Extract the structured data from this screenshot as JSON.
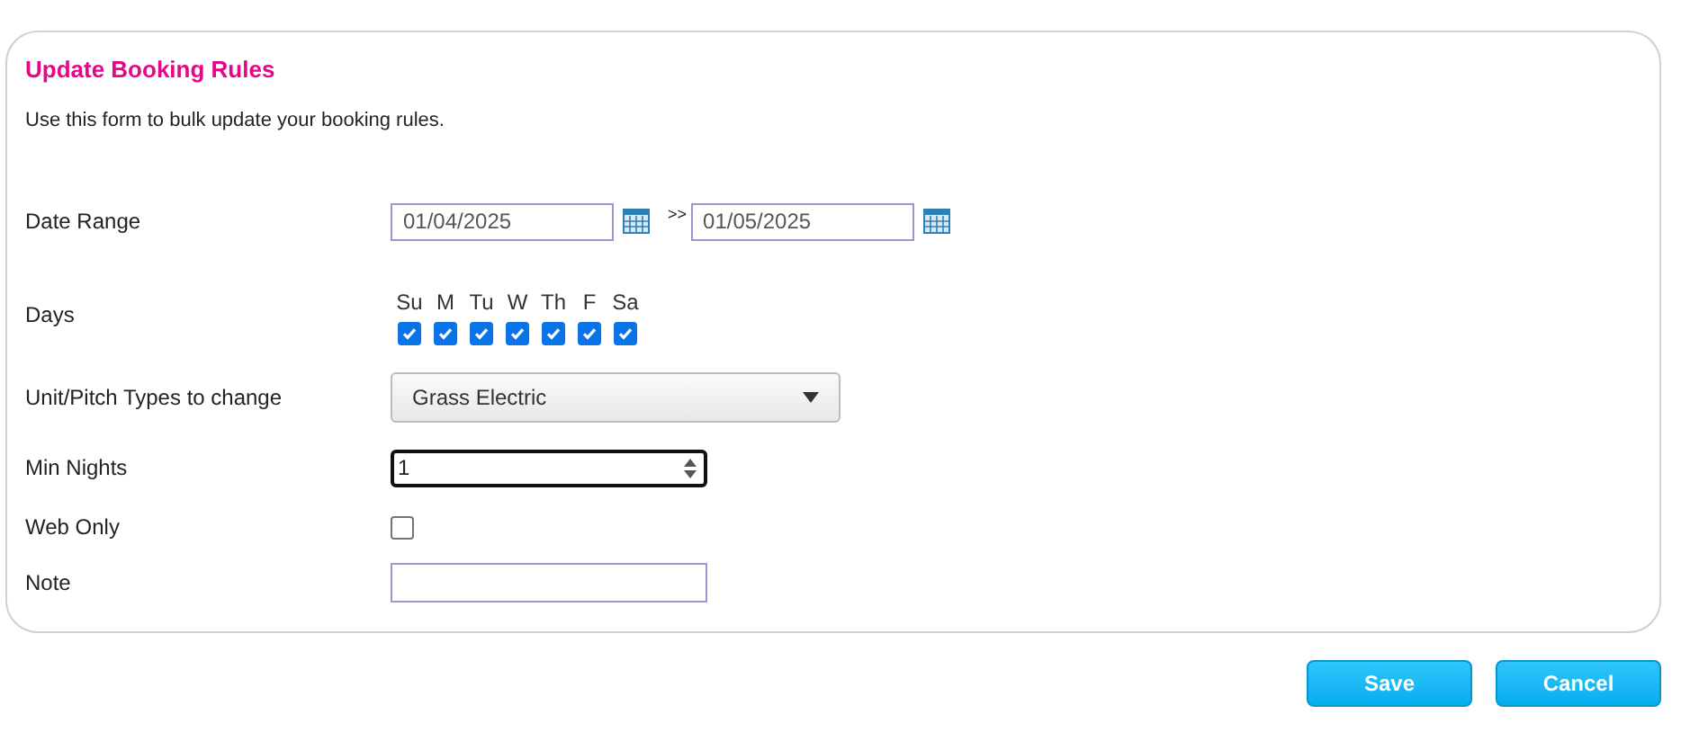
{
  "title": "Update Booking Rules",
  "intro": "Use this form to bulk update your booking rules.",
  "fields": [
    {
      "kind": "daterange",
      "label": "Date Range",
      "from": "01/04/2025",
      "separator": ">>",
      "to": "01/05/2025"
    },
    {
      "kind": "days",
      "label": "Days",
      "days": [
        {
          "label": "Su",
          "checked": true
        },
        {
          "label": "M",
          "checked": true
        },
        {
          "label": "Tu",
          "checked": true
        },
        {
          "label": "W",
          "checked": true
        },
        {
          "label": "Th",
          "checked": true
        },
        {
          "label": "F",
          "checked": true
        },
        {
          "label": "Sa",
          "checked": true
        }
      ]
    },
    {
      "kind": "select",
      "label": "Unit/Pitch Types to change",
      "value": "Grass Electric"
    },
    {
      "kind": "number",
      "label": "Min Nights",
      "value": "1"
    },
    {
      "kind": "checkbox",
      "label": "Web Only",
      "checked": false
    },
    {
      "kind": "text",
      "label": "Note"
    }
  ],
  "buttons": [
    "Save",
    "Cancel"
  ]
}
